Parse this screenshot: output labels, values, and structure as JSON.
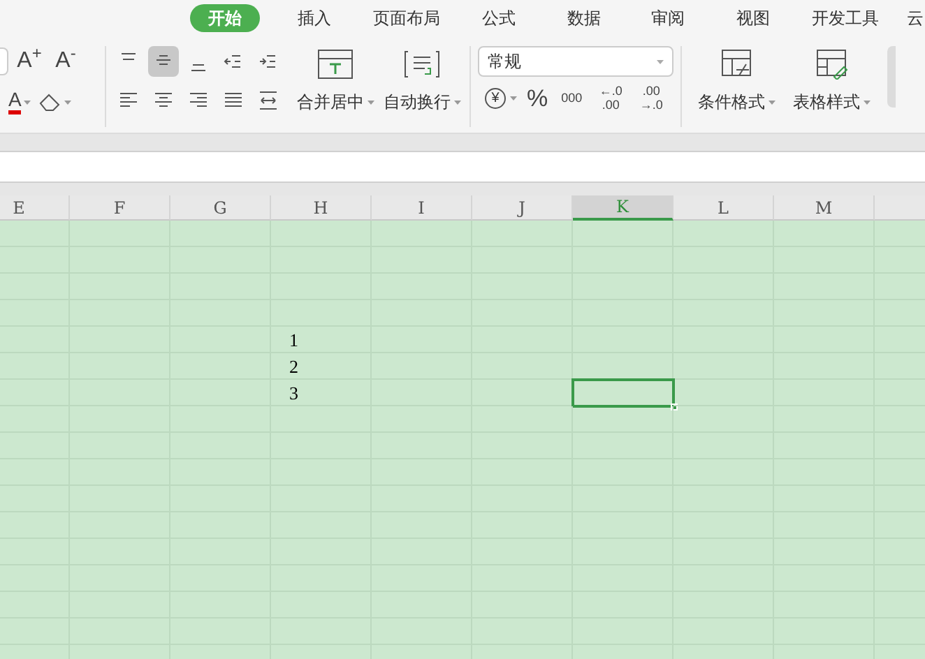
{
  "tabs": [
    {
      "label": "开始",
      "selected": true
    },
    {
      "label": "插入",
      "selected": false
    },
    {
      "label": "页面布局",
      "selected": false
    },
    {
      "label": "公式",
      "selected": false
    },
    {
      "label": "数据",
      "selected": false
    },
    {
      "label": "审阅",
      "selected": false
    },
    {
      "label": "视图",
      "selected": false
    },
    {
      "label": "开发工具",
      "selected": false
    },
    {
      "label": "云",
      "selected": false
    }
  ],
  "font_group": {
    "size_buttons": [
      "A$^{+}$",
      "A$^{-}$"
    ],
    "font_color_button": "A"
  },
  "alignment": {
    "top_row": [
      {
        "kind": "align-top",
        "selected": false
      },
      {
        "kind": "align-middle",
        "selected": true
      },
      {
        "kind": "align-bottom",
        "selected": false
      },
      {
        "kind": "outdent",
        "selected": false
      },
      {
        "kind": "indent",
        "selected": false
      }
    ],
    "bottom_row": [
      {
        "kind": "align-left"
      },
      {
        "kind": "align-center"
      },
      {
        "kind": "align-right"
      },
      {
        "kind": "justify"
      },
      {
        "kind": "distribute"
      }
    ]
  },
  "merge_button": "合并居中",
  "wrap_button": "自动换行",
  "number_format": {
    "value": "常规",
    "currency": "¥",
    "percent": "%",
    "thousands": "000",
    "decimals": [
      {
        "top": "←.0",
        "bottom": ".00"
      },
      {
        "top": ".00",
        "bottom": "→.0"
      }
    ]
  },
  "style_buttons": [
    "条件格式",
    "表格样式"
  ],
  "columns": [
    {
      "label": "E",
      "selected": false
    },
    {
      "label": "F",
      "selected": false
    },
    {
      "label": "G",
      "selected": false
    },
    {
      "label": "H",
      "selected": false
    },
    {
      "label": "I",
      "selected": false
    },
    {
      "label": "J",
      "selected": false
    },
    {
      "label": "K",
      "selected": true
    },
    {
      "label": "L",
      "selected": false
    },
    {
      "label": "M",
      "selected": false
    }
  ],
  "rows": [
    {
      "selected": false,
      "cells": {}
    },
    {
      "selected": false,
      "cells": {}
    },
    {
      "selected": false,
      "cells": {}
    },
    {
      "selected": false,
      "cells": {}
    },
    {
      "selected": false,
      "cells": {
        "H": "1"
      }
    },
    {
      "selected": false,
      "cells": {
        "H": "2"
      }
    },
    {
      "selected": true,
      "cells": {
        "H": "3"
      }
    },
    {
      "selected": false,
      "cells": {}
    },
    {
      "selected": false,
      "cells": {}
    },
    {
      "selected": false,
      "cells": {}
    },
    {
      "selected": false,
      "cells": {}
    },
    {
      "selected": false,
      "cells": {}
    },
    {
      "selected": false,
      "cells": {}
    },
    {
      "selected": false,
      "cells": {}
    },
    {
      "selected": false,
      "cells": {}
    },
    {
      "selected": false,
      "cells": {}
    },
    {
      "selected": false,
      "cells": {}
    }
  ]
}
